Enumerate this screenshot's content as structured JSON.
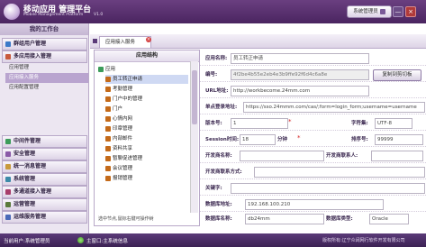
{
  "header": {
    "title": "移动应用 管理平台",
    "subtitle": "Mobile Management Platform",
    "version": "V1.0",
    "sysmgr_label": "系统管理员",
    "min_label": "—",
    "close_label": "×"
  },
  "nav": {
    "title": "我的工作台",
    "group_user": "群组用户管理",
    "group_app": "多应用接入管理",
    "sub_items": [
      "应用管理",
      "应用接入服务",
      "应用配置管理"
    ],
    "bottom_groups": [
      "中间件管理",
      "安全管理",
      "统一消息管理",
      "系统管理",
      "多通道接入管理",
      "运营管理",
      "运维服务管理"
    ],
    "colors": [
      "#3c7ac8",
      "#c85a3c",
      "#3c9c5a",
      "#8a5aa8",
      "#c89a3c",
      "#3c8aa8",
      "#a83c6a",
      "#5a7a3c",
      "#4a6ab8"
    ]
  },
  "tabs": {
    "active": "应用接入服务",
    "close": "×"
  },
  "tree": {
    "header": "应用结构",
    "root": "应用",
    "items": [
      "员工转正申请",
      "考勤管理",
      "门户中的管理",
      "门户",
      "心情内网",
      "印章管理",
      "内部邮件",
      "资料共享",
      "暂聊促进管理",
      "会议管理",
      "报销管理"
    ],
    "hint": "选中节点,鼠标右键可操作树"
  },
  "form": {
    "app_name_label": "应用名称:",
    "app_name_value": "员工转正申请",
    "code_label": "编号:",
    "code_value": "4f2be4b55e2eb4e3b9ffe92f6d4c6a8e",
    "copy_btn": "复制到剪切板",
    "url_label": "URL地址:",
    "url_value": "http://workbecome.24mm.com",
    "sso_label": "单点登录地址:",
    "sso_value": "https://sso.24mmm.com/cas/;form=login_form;username=username",
    "version_label": "版本号:",
    "version_value": "1",
    "charset_label": "字符集:",
    "charset_value": "UTF-8",
    "session_label": "Session时间:",
    "session_value": "18",
    "session_unit": "分钟",
    "sort_label": "排序号:",
    "sort_value": "99999",
    "dev_label": "开发商名称:",
    "dev_contact_label": "开发商联系人:",
    "dev_contact_method_label": "开发商联系方式:",
    "keyword_label": "关键字:",
    "db_addr_label": "数据库地址:",
    "db_addr_value": "192.168.100.210",
    "db_name_label": "数据库名称:",
    "db_name_value": "db24mm",
    "db_type_label": "数据库类型:",
    "db_type_value": "Oracle"
  },
  "status": {
    "left": "当前用户:系统管理员",
    "mid": "主窗口:主系统信息",
    "right": "版权所有:辽宁众阔网行软件开发有限公司"
  }
}
